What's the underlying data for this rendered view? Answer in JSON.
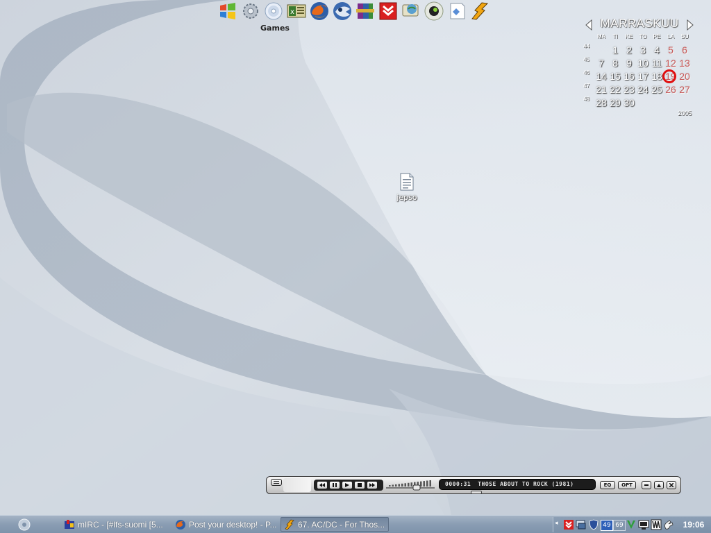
{
  "dock": {
    "label": "Games",
    "icons": [
      "windows-icon",
      "gear-icon",
      "cd-icon",
      "excel-icon",
      "firefox-icon",
      "thunderbird-icon",
      "winrar-icon",
      "download-arrow-icon",
      "network-globe-icon",
      "camera-icon",
      "paper-icon",
      "winamp-icon"
    ]
  },
  "calendar": {
    "month": "MARRASKUU",
    "year": "2005",
    "weekdays": [
      "MA",
      "TI",
      "KE",
      "TO",
      "PE",
      "LA",
      "SU"
    ],
    "weeks": [
      "44",
      "45",
      "46",
      "47",
      "48"
    ],
    "today": "19",
    "days": [
      [
        "",
        "1",
        "2",
        "3",
        "4",
        "5",
        "6"
      ],
      [
        "7",
        "8",
        "9",
        "10",
        "11",
        "12",
        "13"
      ],
      [
        "14",
        "15",
        "16",
        "17",
        "18",
        "19",
        "20"
      ],
      [
        "21",
        "22",
        "23",
        "24",
        "25",
        "26",
        "27"
      ],
      [
        "28",
        "29",
        "30",
        "",
        "",
        "",
        ""
      ]
    ],
    "colors": {
      "weekday": "#ffffff",
      "weekend": "#c85a5a",
      "today_ring": "#e01010"
    }
  },
  "desktop": {
    "file": {
      "label": "jepso",
      "icon": "text-file-icon"
    }
  },
  "player": {
    "time": "0000:31",
    "track": "THOSE ABOUT TO ROCK (1981)",
    "eq_label": "EQ",
    "opt_label": "OPT",
    "volume": 0.65,
    "seek": 0.2
  },
  "taskbar": {
    "tasks": [
      {
        "label": "mIRC - [#lfs-suomi [5...",
        "icon": "mirc-icon"
      },
      {
        "label": "Post your desktop! - P...",
        "icon": "firefox-icon"
      },
      {
        "label": "67. AC/DC - For Thos...",
        "icon": "winamp-icon"
      }
    ],
    "tray": {
      "num1": "49",
      "num2": "69"
    },
    "clock": "19:06"
  }
}
